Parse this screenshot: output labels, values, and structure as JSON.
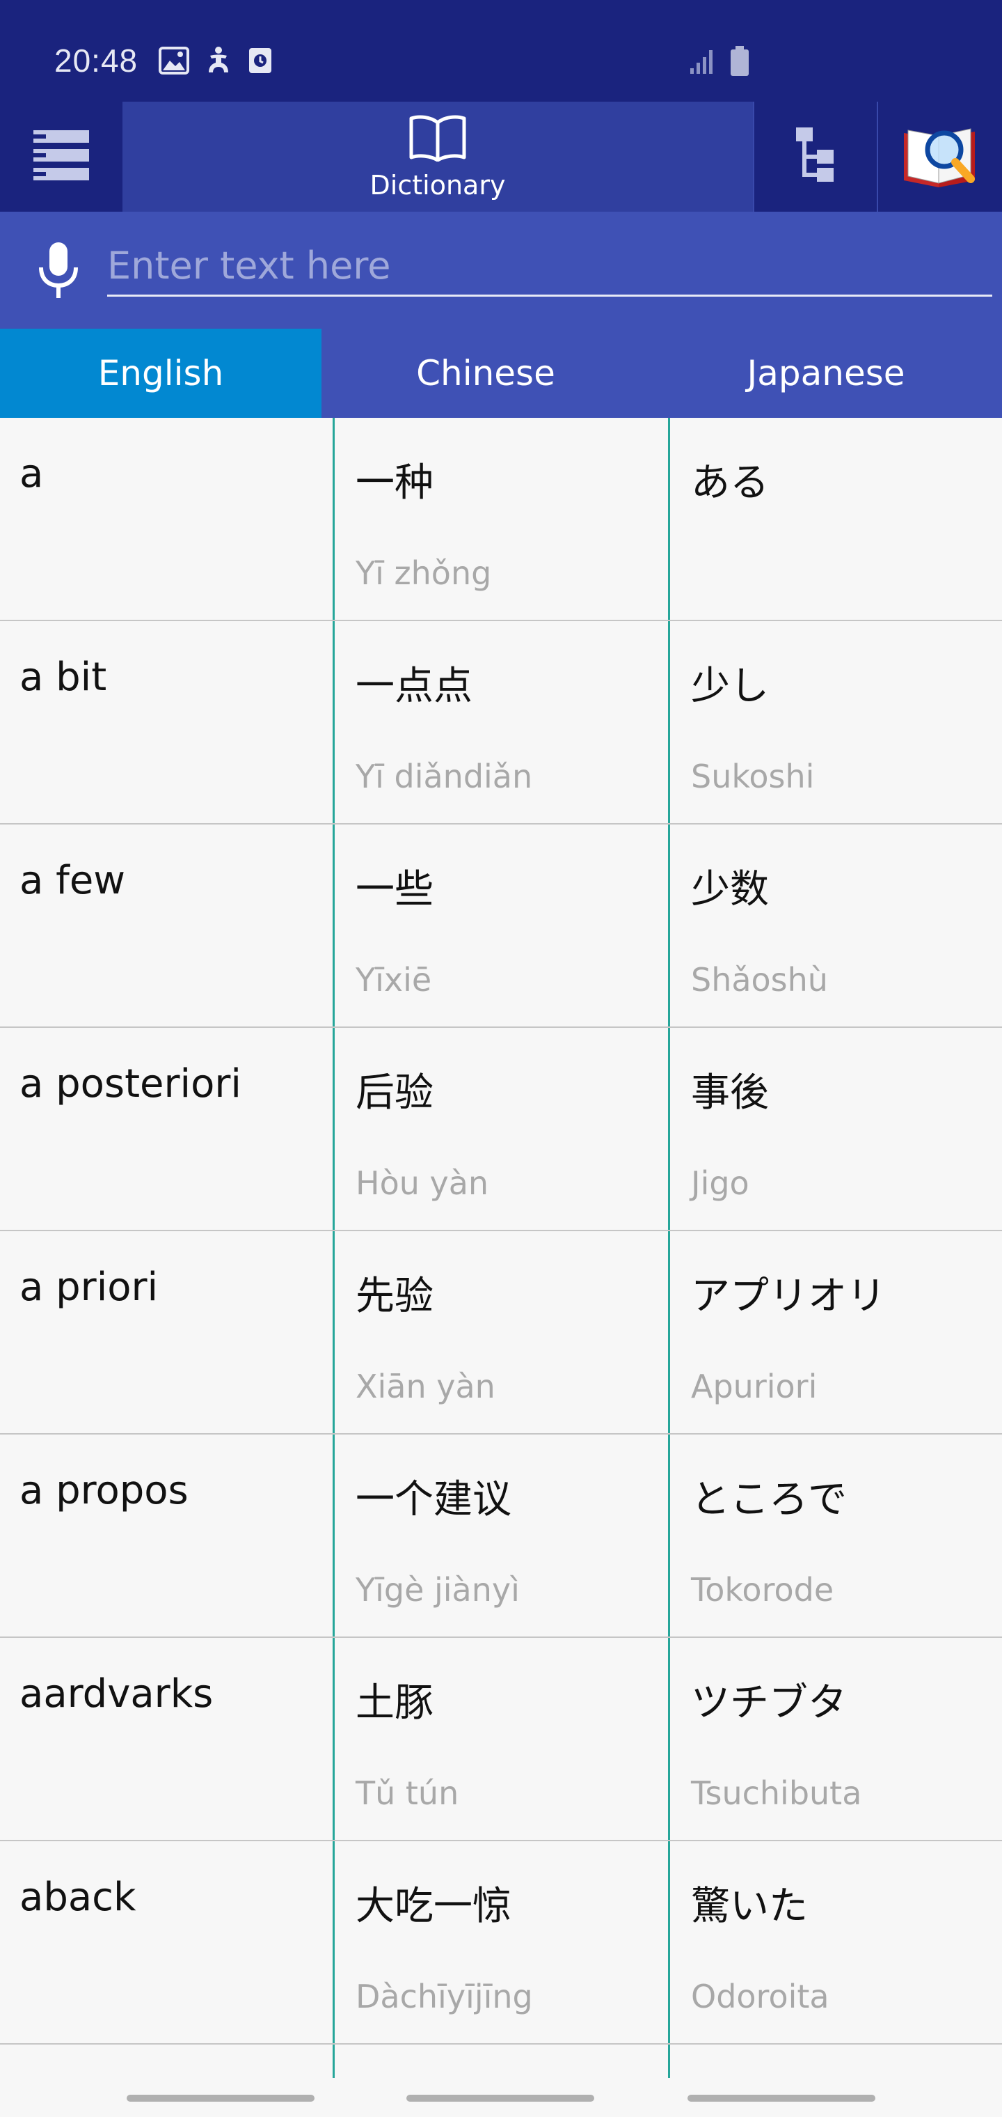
{
  "status_bar": {
    "time": "20:48",
    "icons_left": [
      "image-icon",
      "accessibility-icon",
      "clock-widget-icon"
    ],
    "icons_right": [
      "signal-icon",
      "battery-icon"
    ]
  },
  "toolbar": {
    "menu_icon": "menu-icon",
    "dictionary_label": "Dictionary",
    "tree_icon": "hierarchy-icon",
    "book_icon": "book-search-icon"
  },
  "search": {
    "placeholder": "Enter text here",
    "value": ""
  },
  "language_tabs": [
    {
      "label": "English",
      "active": true
    },
    {
      "label": "Chinese",
      "active": false
    },
    {
      "label": "Japanese",
      "active": false
    }
  ],
  "entries": [
    {
      "english": "a",
      "chinese": "一种",
      "chinese_roman": "Yī zhǒng",
      "japanese": "ある",
      "japanese_roman": ""
    },
    {
      "english": "a bit",
      "chinese": "一点点",
      "chinese_roman": "Yī diǎndiǎn",
      "japanese": "少し",
      "japanese_roman": "Sukoshi"
    },
    {
      "english": "a few",
      "chinese": "一些",
      "chinese_roman": "Yīxiē",
      "japanese": "少数",
      "japanese_roman": "Shǎoshù"
    },
    {
      "english": "a posteriori",
      "chinese": "后验",
      "chinese_roman": "Hòu yàn",
      "japanese": "事後",
      "japanese_roman": "Jigo"
    },
    {
      "english": "a priori",
      "chinese": "先验",
      "chinese_roman": "Xiān yàn",
      "japanese": "アプリオリ",
      "japanese_roman": "Apuriori"
    },
    {
      "english": "a propos",
      "chinese": "一个建议",
      "chinese_roman": "Yīgè jiànyì",
      "japanese": "ところで",
      "japanese_roman": "Tokorode"
    },
    {
      "english": "aardvarks",
      "chinese": "土豚",
      "chinese_roman": "Tǔ tún",
      "japanese": "ツチブタ",
      "japanese_roman": "Tsuchibuta"
    },
    {
      "english": "aback",
      "chinese": "大吃一惊",
      "chinese_roman": "Dàchīyījīng",
      "japanese": "驚いた",
      "japanese_roman": "Odoroita"
    }
  ],
  "colors": {
    "status_bar": "#1a237e",
    "active_tab": "#303f9f",
    "search_bar": "#3f51b5",
    "selected_language": "#0288d1",
    "column_divider": "#26a69a"
  }
}
